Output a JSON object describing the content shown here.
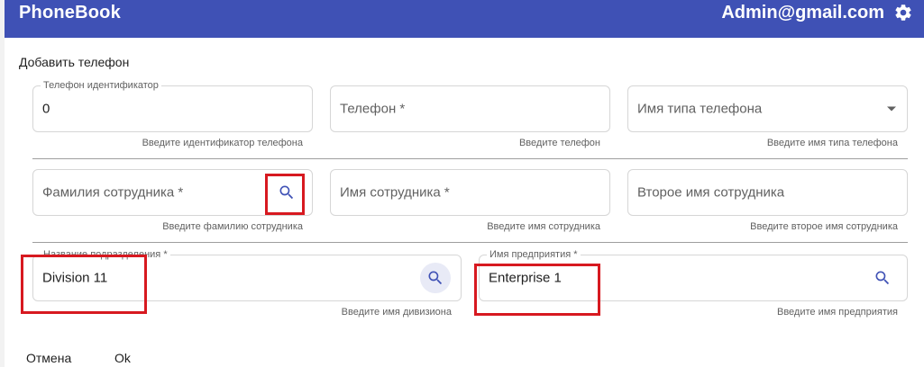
{
  "app": {
    "title": "PhoneBook",
    "user": "Admin@gmail.com"
  },
  "dialog": {
    "title": "Добавить телефон"
  },
  "fields": {
    "phone_id": {
      "label": "Телефон идентификатор",
      "value": "0",
      "helper": "Введите идентификатор телефона"
    },
    "phone": {
      "placeholder": "Телефон *",
      "helper": "Введите телефон"
    },
    "phone_type": {
      "placeholder": "Имя типа телефона",
      "helper": "Введите имя типа телефона"
    },
    "last_name": {
      "placeholder": "Фамилия сотрудника *",
      "helper": "Введите фамилию сотрудника"
    },
    "first_name": {
      "placeholder": "Имя сотрудника *",
      "helper": "Введите имя сотрудника"
    },
    "middle_name": {
      "placeholder": "Второе имя сотрудника",
      "helper": "Введите второе имя сотрудника"
    },
    "division": {
      "label": "Название подразделения *",
      "value": "Division 11",
      "helper": "Введите имя дивизиона"
    },
    "enterprise": {
      "label": "Имя предприятия *",
      "value": "Enterprise 1",
      "helper": "Введите имя предприятия"
    }
  },
  "actions": {
    "cancel": "Отмена",
    "ok": "Ok"
  },
  "colors": {
    "appbar": "#3f51b5",
    "accent": "#3f51b5",
    "highlight": "#d71920"
  }
}
